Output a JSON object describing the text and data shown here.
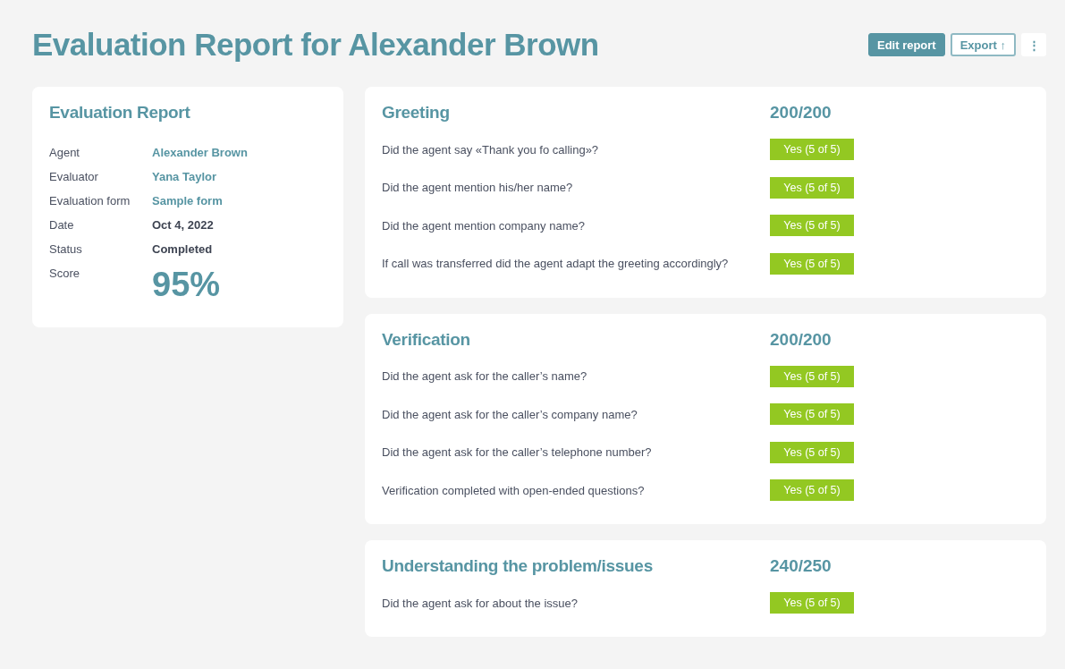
{
  "title": "Evaluation Report for Alexander Brown",
  "actions": [
    {
      "label": "Edit report",
      "kind": "primary"
    },
    {
      "label": "Export ↑",
      "kind": "outline"
    },
    {
      "label": "⋮",
      "kind": "more"
    }
  ],
  "summary": {
    "title": "Evaluation Report",
    "fields": [
      {
        "label": "Agent",
        "value": "Alexander Brown",
        "kind": "link"
      },
      {
        "label": "Evaluator",
        "value": "Yana Taylor",
        "kind": "link"
      },
      {
        "label": "Evaluation form",
        "value": "Sample form",
        "kind": "link"
      },
      {
        "label": "Date",
        "value": "Oct 4, 2022",
        "kind": "text"
      },
      {
        "label": "Status",
        "value": "Completed",
        "kind": "text"
      },
      {
        "label": "Score",
        "value": "95%",
        "kind": "score"
      }
    ]
  },
  "sections": [
    {
      "title": "Greeting",
      "score": "200/200",
      "questions": [
        {
          "text": "Did the agent say «Thank you fo calling»?",
          "answer": "Yes (5 of 5)"
        },
        {
          "text": "Did the agent mention his/her name?",
          "answer": "Yes (5 of 5)"
        },
        {
          "text": "Did the agent mention company name?",
          "answer": "Yes (5 of 5)"
        },
        {
          "text": "If call was transferred did the agent adapt the  greeting accordingly?",
          "answer": "Yes (5 of 5)"
        }
      ]
    },
    {
      "title": "Verification",
      "score": "200/200",
      "questions": [
        {
          "text": "Did the agent ask for the caller’s name?",
          "answer": "Yes (5 of 5)"
        },
        {
          "text": "Did the agent ask for the caller’s company name?",
          "answer": "Yes (5 of 5)"
        },
        {
          "text": "Did the agent ask for the caller’s telephone number?",
          "answer": "Yes (5 of 5)"
        },
        {
          "text": "Verification completed with open-ended questions?",
          "answer": "Yes (5 of 5)"
        }
      ]
    },
    {
      "title": "Understanding the problem/issues",
      "score": "240/250",
      "questions": [
        {
          "text": "Did the agent ask for about the issue?",
          "answer": "Yes (5 of 5)"
        }
      ]
    }
  ]
}
